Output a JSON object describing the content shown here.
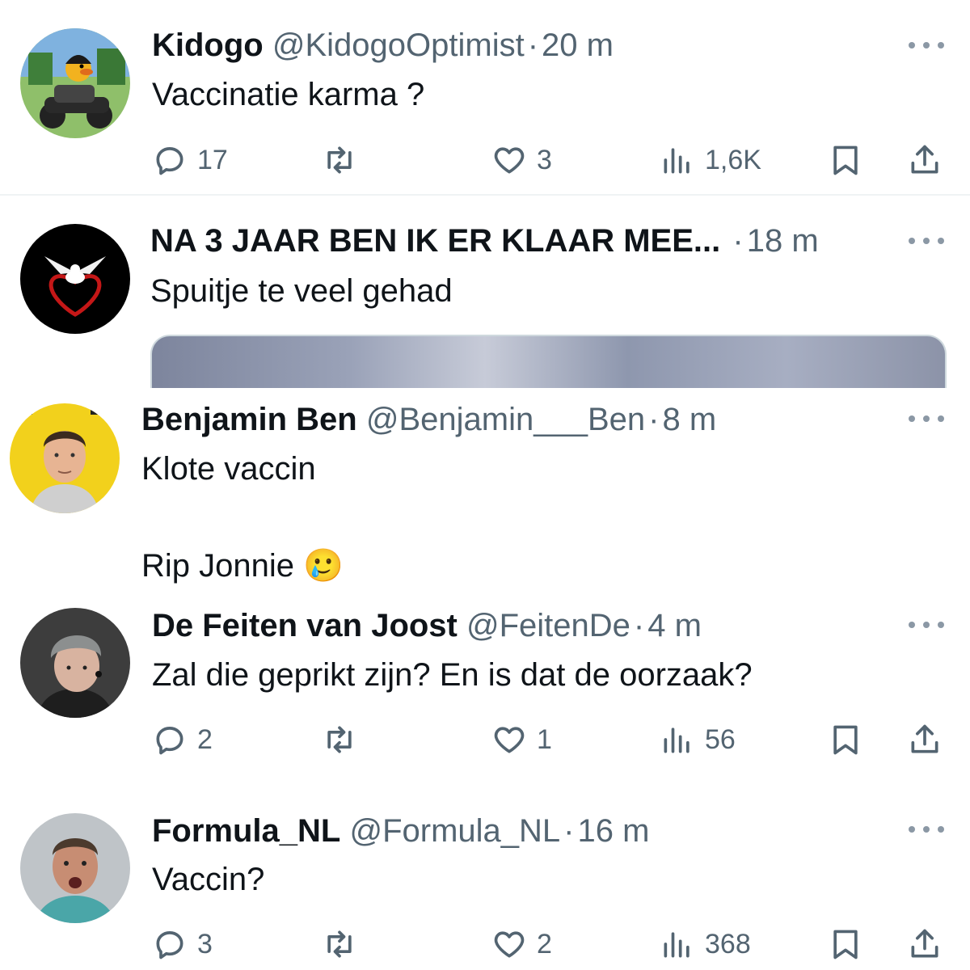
{
  "tweets": [
    {
      "name": "Kidogo",
      "handle": "@KidogoOptimist",
      "time": "20 m",
      "text_lines": [
        "Vaccinatie karma ?"
      ],
      "stats": {
        "replies": "17",
        "retweets": "",
        "likes": "3",
        "views": "1,6K"
      },
      "avatar": "avatar-duck-on-motorcycle"
    },
    {
      "name": "NA 3 JAAR BEN IK ER KLAAR MEE...",
      "handle": "",
      "time": "18 m",
      "text_lines": [
        "Spuitje te veel gehad"
      ],
      "avatar": "avatar-white-dove-red-heart",
      "has_media": true
    },
    {
      "name": "Benjamin Ben",
      "handle": "@Benjamin___Ben",
      "time": "8 m",
      "text_lines": [
        "Klote vaccin",
        "",
        "Rip Jonnie 🥲"
      ],
      "avatar": "avatar-man-yellow-background"
    },
    {
      "name": "De Feiten van Joost",
      "handle": "@FeitenDe",
      "time": "4 m",
      "text_lines": [
        "Zal die geprikt zijn? En is dat de oorzaak?"
      ],
      "stats": {
        "replies": "2",
        "retweets": "",
        "likes": "1",
        "views": "56"
      },
      "avatar": "avatar-man-grey-beanie"
    },
    {
      "name": "Formula_NL",
      "handle": "@Formula_NL",
      "time": "16 m",
      "text_lines": [
        "Vaccin?"
      ],
      "stats": {
        "replies": "3",
        "retweets": "",
        "likes": "2",
        "views": "368"
      },
      "avatar": "avatar-man-shouting"
    }
  ],
  "separator": "·",
  "icons": {
    "reply": "reply-bubble-icon",
    "retweet": "retweet-icon",
    "like": "heart-icon",
    "views": "views-bar-chart-icon",
    "bookmark": "bookmark-icon",
    "share": "share-upload-icon",
    "more": "more-dots-icon"
  },
  "colors": {
    "text": "#0f1419",
    "secondary": "#536471",
    "divider": "#eff3f4",
    "background": "#ffffff"
  }
}
